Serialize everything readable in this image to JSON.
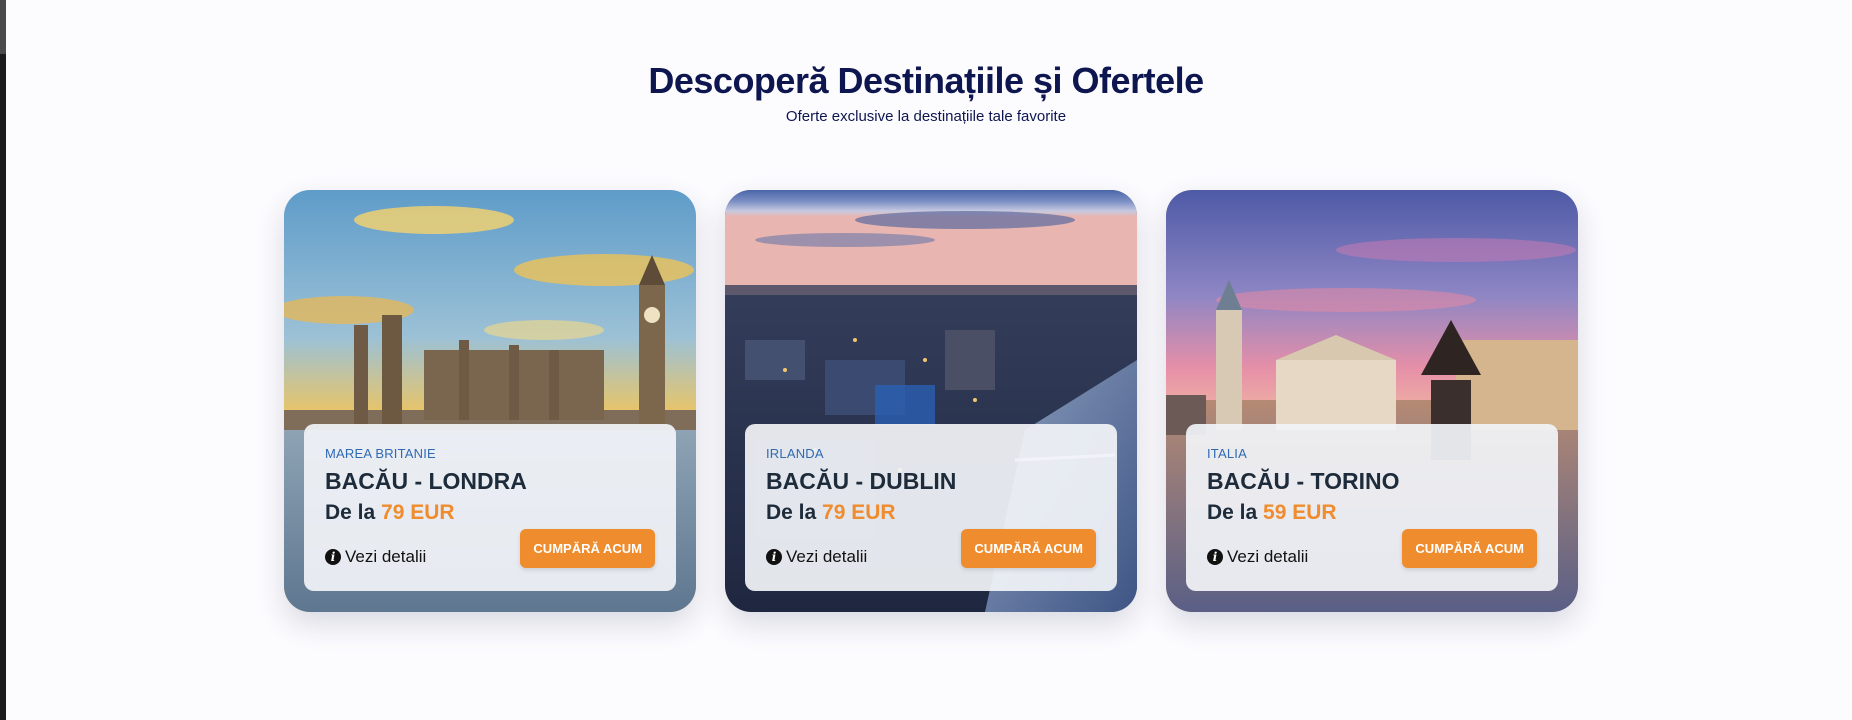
{
  "section": {
    "title": "Descoperă Destinațiile și Ofertele",
    "subtitle": "Oferte exclusive la destinațiile tale favorite"
  },
  "cards": [
    {
      "country": "MAREA BRITANIE",
      "route": "BACĂU - LONDRA",
      "price_prefix": "De la",
      "price": "79 EUR",
      "details_label": "Vezi detalii",
      "buy_label": "CUMPĂRĂ ACUM",
      "image": "london-big-ben-photo"
    },
    {
      "country": "IRLANDA",
      "route": "BACĂU - DUBLIN",
      "price_prefix": "De la",
      "price": "79 EUR",
      "details_label": "Vezi detalii",
      "buy_label": "CUMPĂRĂ ACUM",
      "image": "dublin-night-city-photo"
    },
    {
      "country": "ITALIA",
      "route": "BACĂU - TORINO",
      "price_prefix": "De la",
      "price": "59 EUR",
      "details_label": "Vezi detalii",
      "buy_label": "CUMPĂRĂ ACUM",
      "image": "turin-piazza-sunset-photo"
    }
  ],
  "colors": {
    "title": "#0e1650",
    "accent_orange": "#ef8c2e",
    "country_blue": "#2f6ab3",
    "text_dark": "#1e2b3a",
    "background": "#fcfbfe"
  },
  "icons": {
    "details_icon": "info-circle-icon"
  }
}
